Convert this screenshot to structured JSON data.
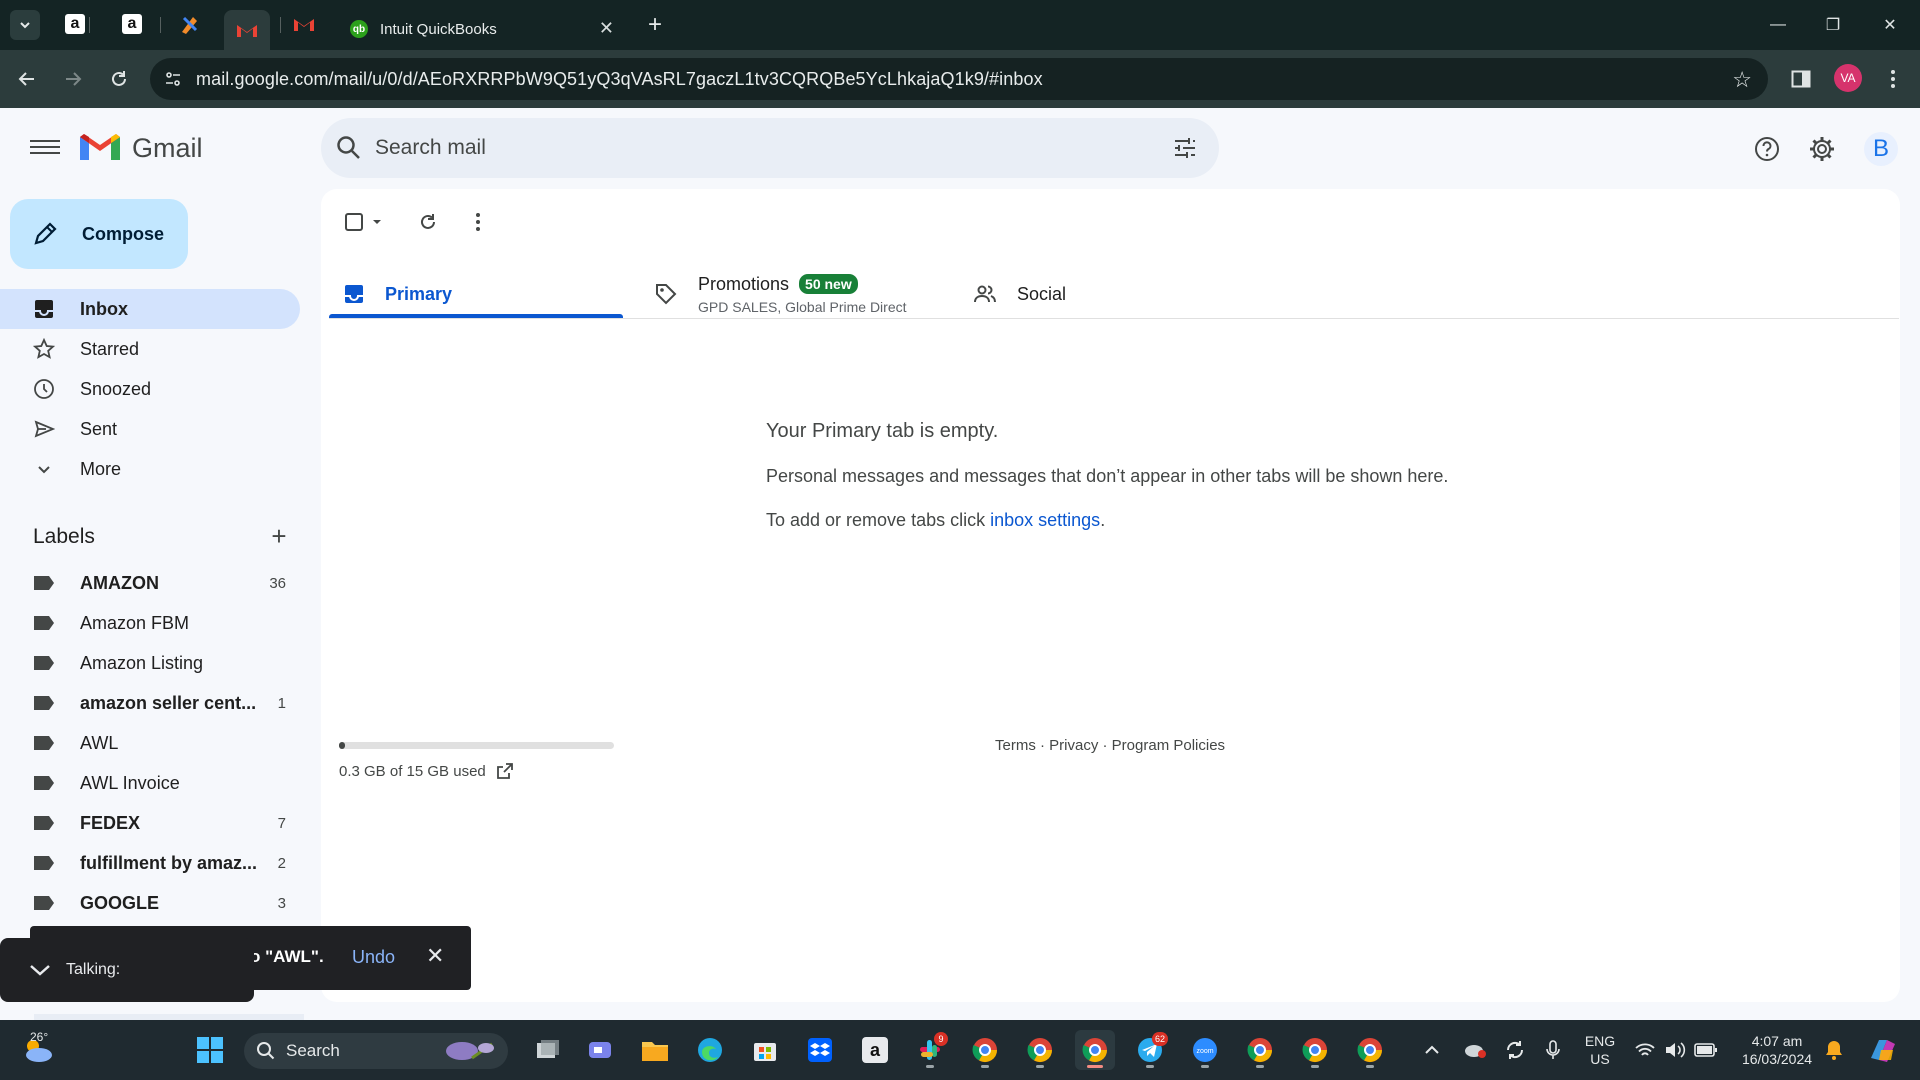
{
  "browser": {
    "tabs": [
      {
        "name": "amazon-tab-1",
        "icon": "amazon-icon"
      },
      {
        "name": "amazon-tab-2",
        "icon": "amazon-icon"
      },
      {
        "name": "tools-tab",
        "icon": "pencil-ruler-icon"
      },
      {
        "name": "gmail-tab-active",
        "icon": "gmail-icon"
      },
      {
        "name": "gmail-tab-2",
        "icon": "gmail-icon"
      }
    ],
    "active_tab_title": "Intuit QuickBooks",
    "url": "mail.google.com/mail/u/0/d/AEoRXRRPbW9Q51yQ3qVAsRL7gaczL1tv3CQRQBe5YcLhkajaQ1k9/#inbox",
    "profile_initials": "VA"
  },
  "gmail": {
    "brand": "Gmail",
    "search_placeholder": "Search mail",
    "account_initial": "B",
    "compose_label": "Compose",
    "nav": [
      {
        "label": "Inbox",
        "icon": "inbox-icon",
        "active": true
      },
      {
        "label": "Starred",
        "icon": "star-icon",
        "active": false
      },
      {
        "label": "Snoozed",
        "icon": "clock-icon",
        "active": false
      },
      {
        "label": "Sent",
        "icon": "send-icon",
        "active": false
      },
      {
        "label": "More",
        "icon": "chevron-down-icon",
        "active": false
      }
    ],
    "labels_heading": "Labels",
    "labels": [
      {
        "name": "AMAZON",
        "count": "36",
        "bold": true
      },
      {
        "name": "Amazon FBM",
        "count": "",
        "bold": false
      },
      {
        "name": "Amazon Listing",
        "count": "",
        "bold": false
      },
      {
        "name": "amazon seller cent...",
        "count": "1",
        "bold": true
      },
      {
        "name": "AWL",
        "count": "",
        "bold": false
      },
      {
        "name": "AWL Invoice",
        "count": "",
        "bold": false
      },
      {
        "name": "FEDEX",
        "count": "7",
        "bold": true
      },
      {
        "name": "fulfillment by amaz...",
        "count": "2",
        "bold": true
      },
      {
        "name": "GOOGLE",
        "count": "3",
        "bold": true
      }
    ],
    "tabs": {
      "primary": "Primary",
      "promotions": "Promotions",
      "promotions_badge": "50 new",
      "promotions_sub": "GPD SALES, Global Prime Direct",
      "social": "Social"
    },
    "empty": {
      "title": "Your Primary tab is empty.",
      "line1": "Personal messages and messages that don’t appear in other tabs will be shown here.",
      "line2_prefix": "To add or remove tabs click ",
      "line2_link": "inbox settings",
      "line2_suffix": "."
    },
    "storage": {
      "text": "0.3 GB of 15 GB used",
      "fraction": 0.02
    },
    "footer": "Terms · Privacy · Program Policies",
    "snackbar": {
      "text": "o \"AWL\".",
      "undo": "Undo"
    },
    "talking": "Talking:"
  },
  "taskbar": {
    "weather": "26°",
    "search_label": "Search",
    "lang": "ENG",
    "region": "US",
    "time": "4:07 am",
    "date": "16/03/2024",
    "badges": {
      "slack": "9",
      "telegram": "62"
    }
  }
}
